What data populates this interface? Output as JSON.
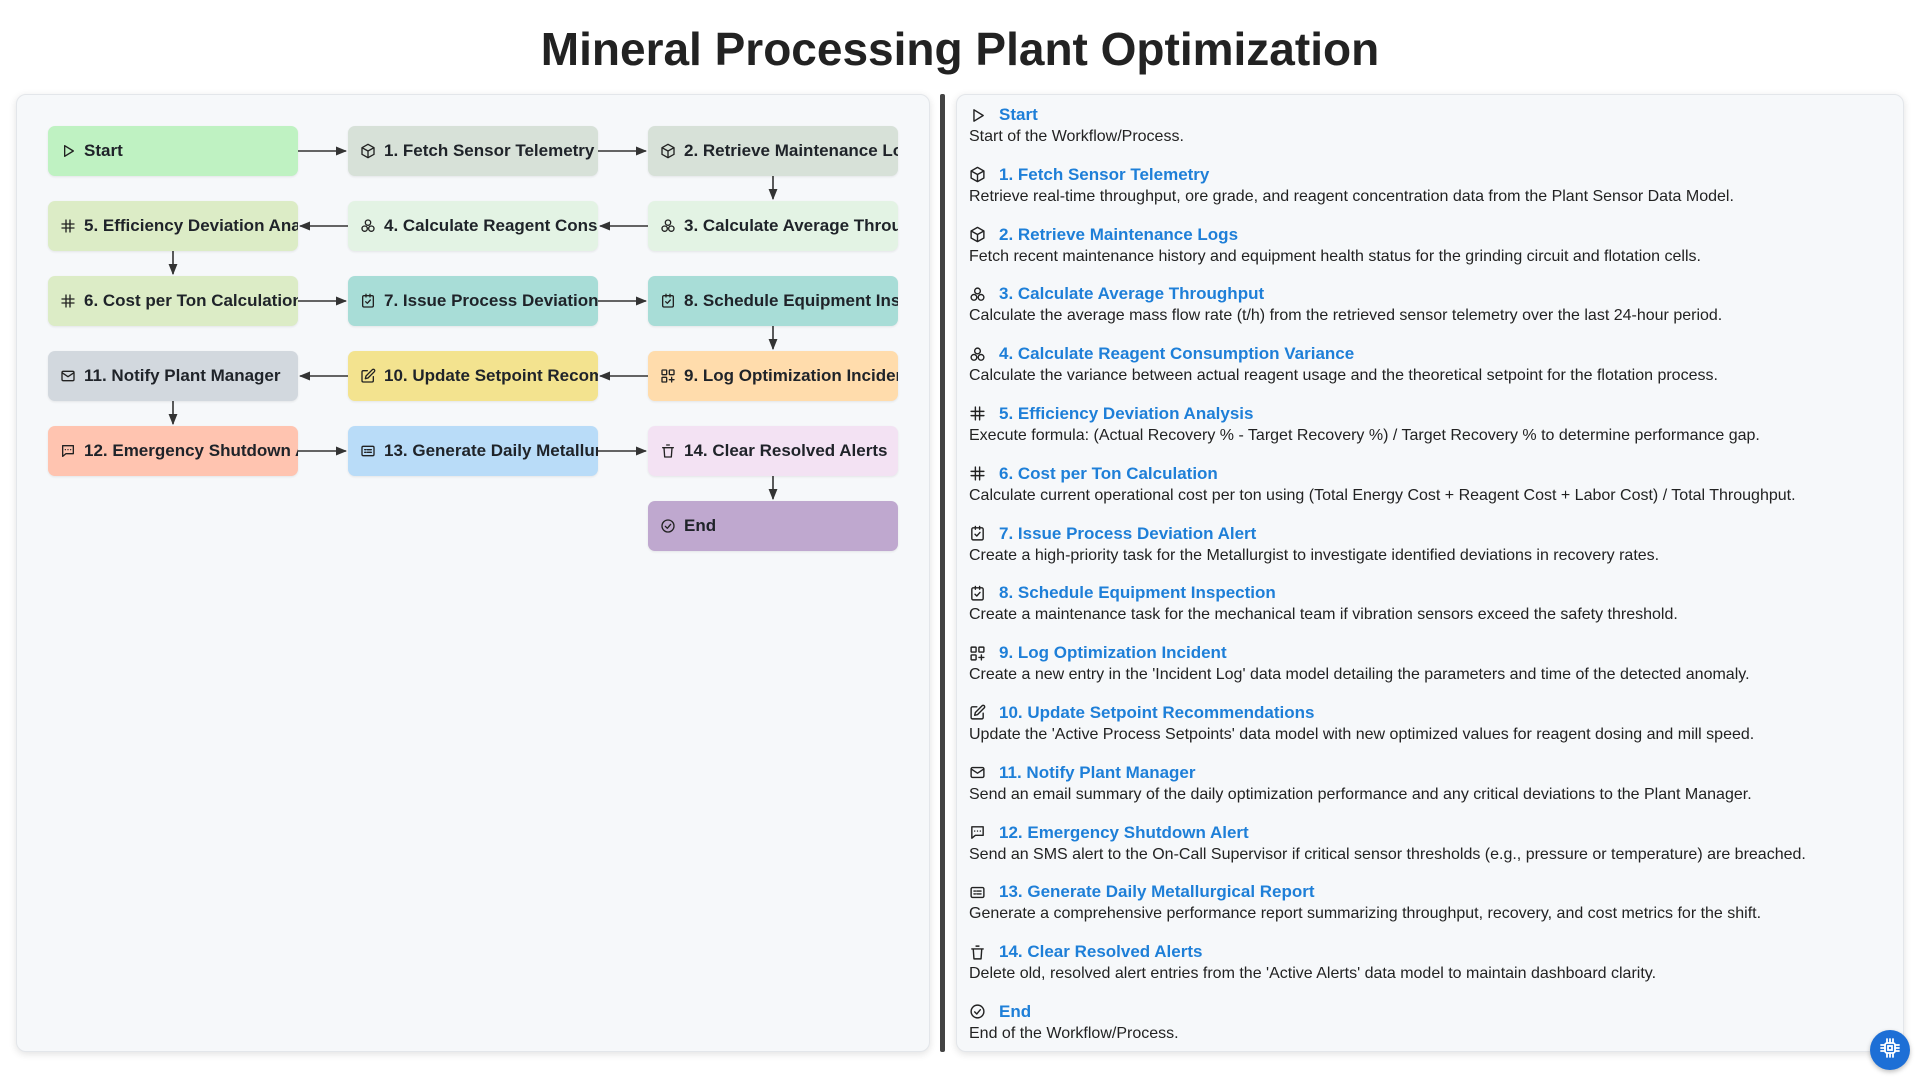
{
  "title": "Mineral Processing Plant Optimization",
  "nodes": [
    {
      "id": "start",
      "label": "Start",
      "icon": "play-icon",
      "color": "#bff2c2"
    },
    {
      "id": "n1",
      "label": "1. Fetch Sensor Telemetry",
      "icon": "cube-icon",
      "color": "#d7e1d8"
    },
    {
      "id": "n2",
      "label": "2. Retrieve Maintenance Lo",
      "icon": "cube-icon",
      "color": "#d7e1d8"
    },
    {
      "id": "n3",
      "label": "3. Calculate Average Throu",
      "icon": "molecule-icon",
      "color": "#e3f3e4"
    },
    {
      "id": "n4",
      "label": "4. Calculate Reagent Consu",
      "icon": "molecule-icon",
      "color": "#e3f3e4"
    },
    {
      "id": "n5",
      "label": "5. Efficiency Deviation Ana",
      "icon": "hash-icon",
      "color": "#dcecc6"
    },
    {
      "id": "n6",
      "label": "6. Cost per Ton Calculation",
      "icon": "hash-icon",
      "color": "#dcecc6"
    },
    {
      "id": "n7",
      "label": "7. Issue Process Deviation",
      "icon": "checkbox-icon",
      "color": "#a8ddd7"
    },
    {
      "id": "n8",
      "label": "8. Schedule Equipment Ins",
      "icon": "checkbox-icon",
      "color": "#a8ddd7"
    },
    {
      "id": "n9",
      "label": "9. Log Optimization Incider",
      "icon": "grid-plus-icon",
      "color": "#ffdcac"
    },
    {
      "id": "n10",
      "label": "10. Update Setpoint Recom",
      "icon": "edit-icon",
      "color": "#f3e38f"
    },
    {
      "id": "n11",
      "label": "11. Notify Plant Manager",
      "icon": "mail-icon",
      "color": "#d2d8de"
    },
    {
      "id": "n12",
      "label": "12. Emergency Shutdown A",
      "icon": "message-icon",
      "color": "#ffc4b0"
    },
    {
      "id": "n13",
      "label": "13. Generate Daily Metallur",
      "icon": "report-icon",
      "color": "#b9dcf8"
    },
    {
      "id": "n14",
      "label": "14. Clear Resolved Alerts",
      "icon": "trash-icon",
      "color": "#f3e2f3"
    },
    {
      "id": "end",
      "label": "End",
      "icon": "check-circle-icon",
      "color": "#bfa8cf"
    }
  ],
  "descriptions": [
    {
      "title": "Start",
      "icon": "play-icon",
      "text": "Start of the Workflow/Process."
    },
    {
      "title": "1. Fetch Sensor Telemetry",
      "icon": "cube-icon",
      "text": "Retrieve real-time throughput, ore grade, and reagent concentration data from the Plant Sensor Data Model."
    },
    {
      "title": "2. Retrieve Maintenance Logs",
      "icon": "cube-icon",
      "text": "Fetch recent maintenance history and equipment health status for the grinding circuit and flotation cells."
    },
    {
      "title": "3. Calculate Average Throughput",
      "icon": "molecule-icon",
      "text": "Calculate the average mass flow rate (t/h) from the retrieved sensor telemetry over the last 24-hour period."
    },
    {
      "title": "4. Calculate Reagent Consumption Variance",
      "icon": "molecule-icon",
      "text": "Calculate the variance between actual reagent usage and the theoretical setpoint for the flotation process."
    },
    {
      "title": "5. Efficiency Deviation Analysis",
      "icon": "hash-icon",
      "text": "Execute formula: (Actual Recovery % - Target Recovery %) / Target Recovery % to determine performance gap."
    },
    {
      "title": "6. Cost per Ton Calculation",
      "icon": "hash-icon",
      "text": "Calculate current operational cost per ton using (Total Energy Cost + Reagent Cost + Labor Cost) / Total Throughput."
    },
    {
      "title": "7. Issue Process Deviation Alert",
      "icon": "checkbox-icon",
      "text": "Create a high-priority task for the Metallurgist to investigate identified deviations in recovery rates."
    },
    {
      "title": "8. Schedule Equipment Inspection",
      "icon": "checkbox-icon",
      "text": "Create a maintenance task for the mechanical team if vibration sensors exceed the safety threshold."
    },
    {
      "title": "9. Log Optimization Incident",
      "icon": "grid-plus-icon",
      "text": "Create a new entry in the 'Incident Log' data model detailing the parameters and time of the detected anomaly."
    },
    {
      "title": "10. Update Setpoint Recommendations",
      "icon": "edit-icon",
      "text": "Update the 'Active Process Setpoints' data model with new optimized values for reagent dosing and mill speed."
    },
    {
      "title": "11. Notify Plant Manager",
      "icon": "mail-icon",
      "text": "Send an email summary of the daily optimization performance and any critical deviations to the Plant Manager."
    },
    {
      "title": "12. Emergency Shutdown Alert",
      "icon": "message-icon",
      "text": "Send an SMS alert to the On-Call Supervisor if critical sensor thresholds (e.g., pressure or temperature) are breached."
    },
    {
      "title": "13. Generate Daily Metallurgical Report",
      "icon": "report-icon",
      "text": "Generate a comprehensive performance report summarizing throughput, recovery, and cost metrics for the shift."
    },
    {
      "title": "14. Clear Resolved Alerts",
      "icon": "trash-icon",
      "text": "Delete old, resolved alert entries from the 'Active Alerts' data model to maintain dashboard clarity."
    },
    {
      "title": "End",
      "icon": "check-circle-icon",
      "text": "End of the Workflow/Process."
    }
  ],
  "fab": {
    "icon": "chip-icon"
  }
}
